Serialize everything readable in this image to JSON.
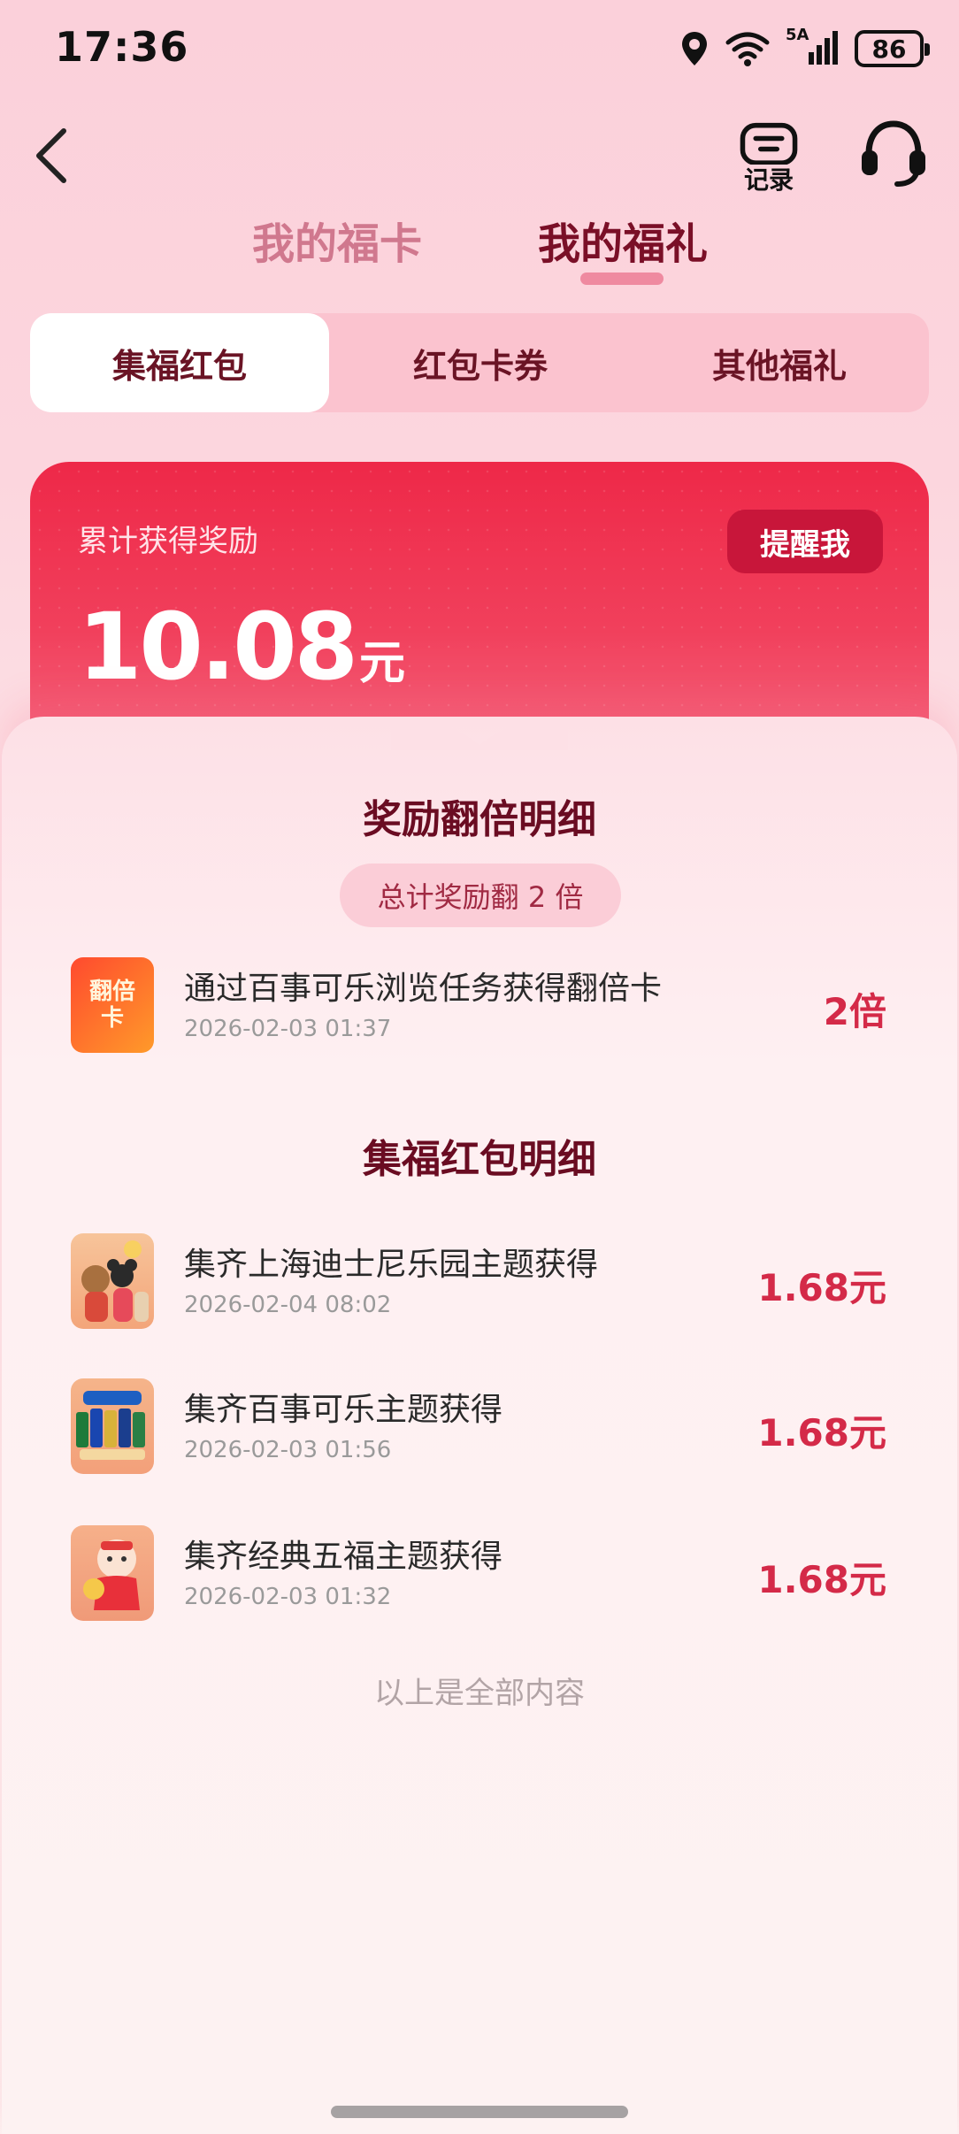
{
  "status_bar": {
    "time": "17:36",
    "network": "5A",
    "battery": "86"
  },
  "header": {
    "record_label": "记录"
  },
  "main_tabs": [
    {
      "label": "我的福卡",
      "active": false
    },
    {
      "label": "我的福礼",
      "active": true
    }
  ],
  "sub_tabs": [
    {
      "label": "集福红包",
      "active": true
    },
    {
      "label": "红包卡券",
      "active": false
    },
    {
      "label": "其他福礼",
      "active": false
    }
  ],
  "reward": {
    "label": "累计获得奖励",
    "amount": "10.08",
    "unit": "元",
    "remind_button": "提醒我"
  },
  "bonus_section": {
    "title": "奖励翻倍明细",
    "total_label": "总计奖励翻 2 倍",
    "items": [
      {
        "title": "通过百事可乐浏览任务获得翻倍卡",
        "time": "2026-02-03 01:37",
        "value": "2倍",
        "icon": "double-card-icon",
        "icon_text": "翻倍卡"
      }
    ]
  },
  "packet_section": {
    "title": "集福红包明细",
    "items": [
      {
        "title": "集齐上海迪士尼乐园主题获得",
        "time": "2026-02-04 08:02",
        "value": "1.68元",
        "icon": "disney-theme-icon"
      },
      {
        "title": "集齐百事可乐主题获得",
        "time": "2026-02-03 01:56",
        "value": "1.68元",
        "icon": "pepsi-theme-icon"
      },
      {
        "title": "集齐经典五福主题获得",
        "time": "2026-02-03 01:32",
        "value": "1.68元",
        "icon": "five-fortune-theme-icon"
      }
    ]
  },
  "footer": "以上是全部内容",
  "colors": {
    "accent": "#d42a48",
    "card_red": "#ee2848",
    "title_dark": "#6a0c22"
  }
}
